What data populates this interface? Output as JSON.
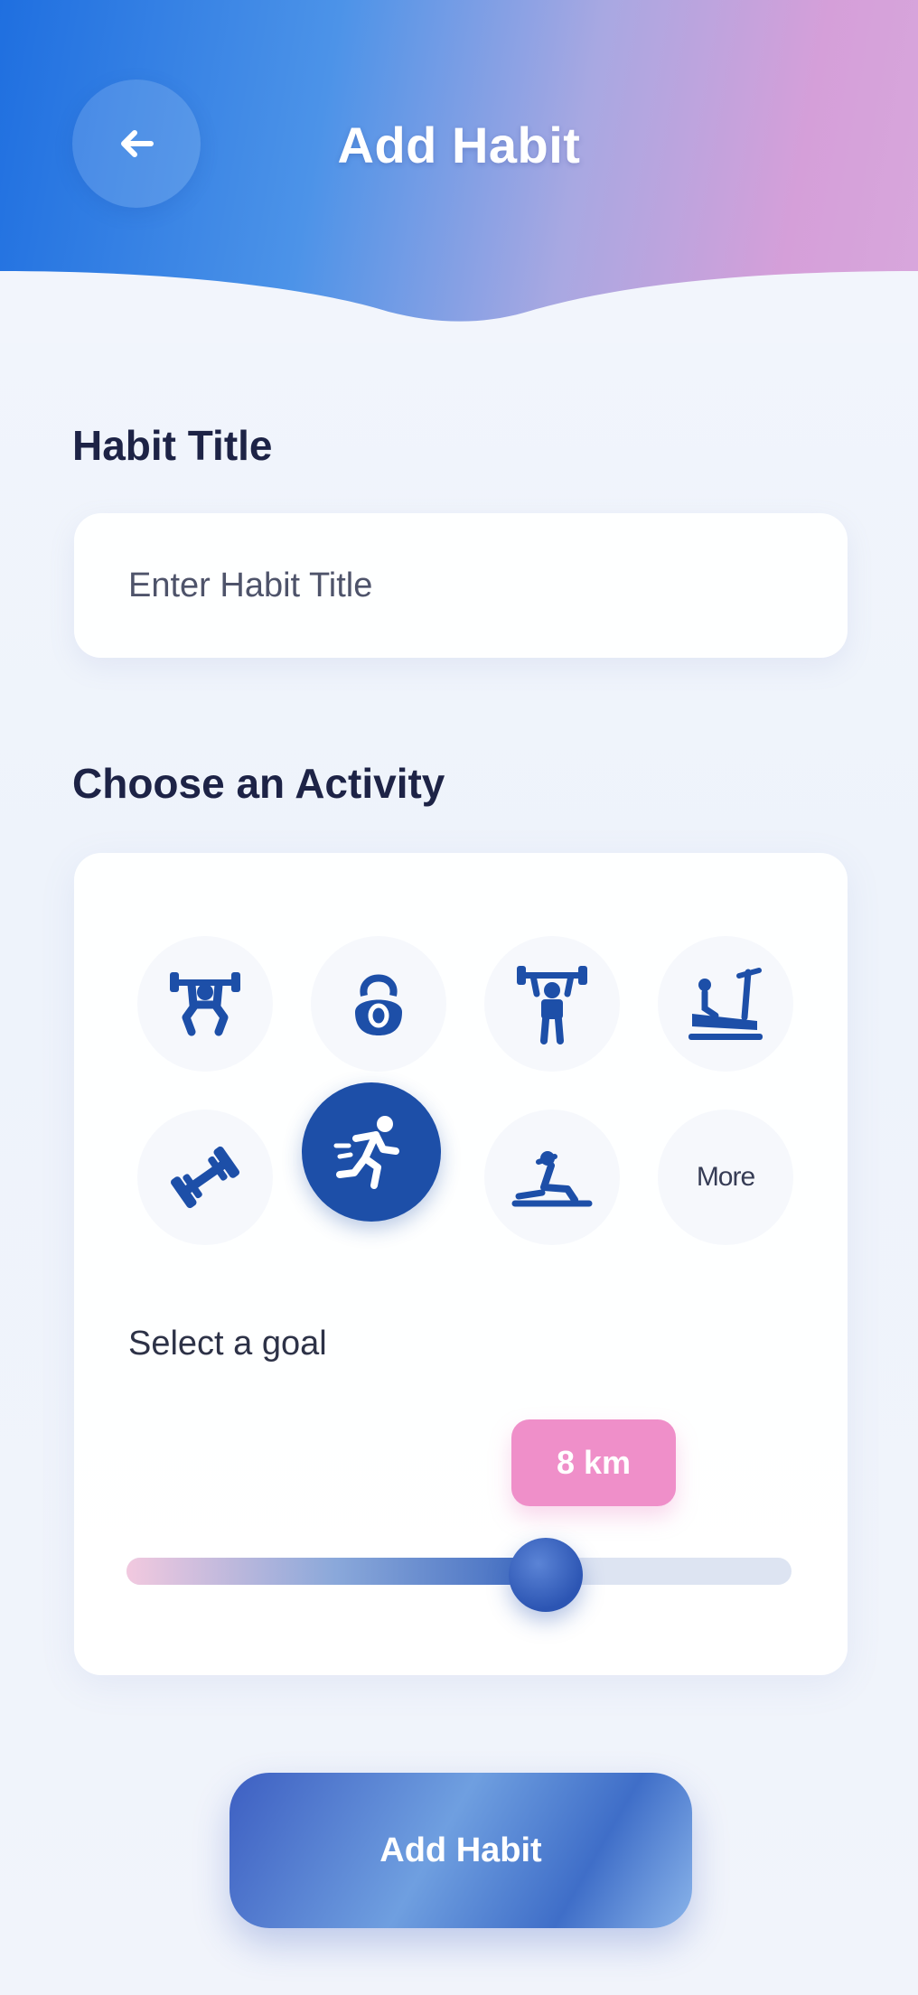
{
  "header": {
    "title": "Add Habit",
    "back_icon": "arrow-left-icon"
  },
  "habit_title": {
    "label": "Habit Title",
    "placeholder": "Enter Habit Title",
    "value": ""
  },
  "activity": {
    "label": "Choose an Activity",
    "options": [
      {
        "icon": "squat-barbell-icon",
        "selected": false
      },
      {
        "icon": "kettlebell-icon",
        "selected": false
      },
      {
        "icon": "overhead-press-icon",
        "selected": false
      },
      {
        "icon": "treadmill-icon",
        "selected": false
      },
      {
        "icon": "dumbbell-icon",
        "selected": false
      },
      {
        "icon": "running-icon",
        "selected": true
      },
      {
        "icon": "situp-icon",
        "selected": false
      },
      {
        "label": "More",
        "selected": false
      }
    ]
  },
  "goal": {
    "label": "Select a goal",
    "value_label": "8 km",
    "slider_fraction": 0.63
  },
  "add_button": {
    "label": "Add Habit"
  },
  "colors": {
    "accent": "#1d4fa8",
    "badge": "#ef8fc9",
    "title_text": "#1d2346"
  }
}
